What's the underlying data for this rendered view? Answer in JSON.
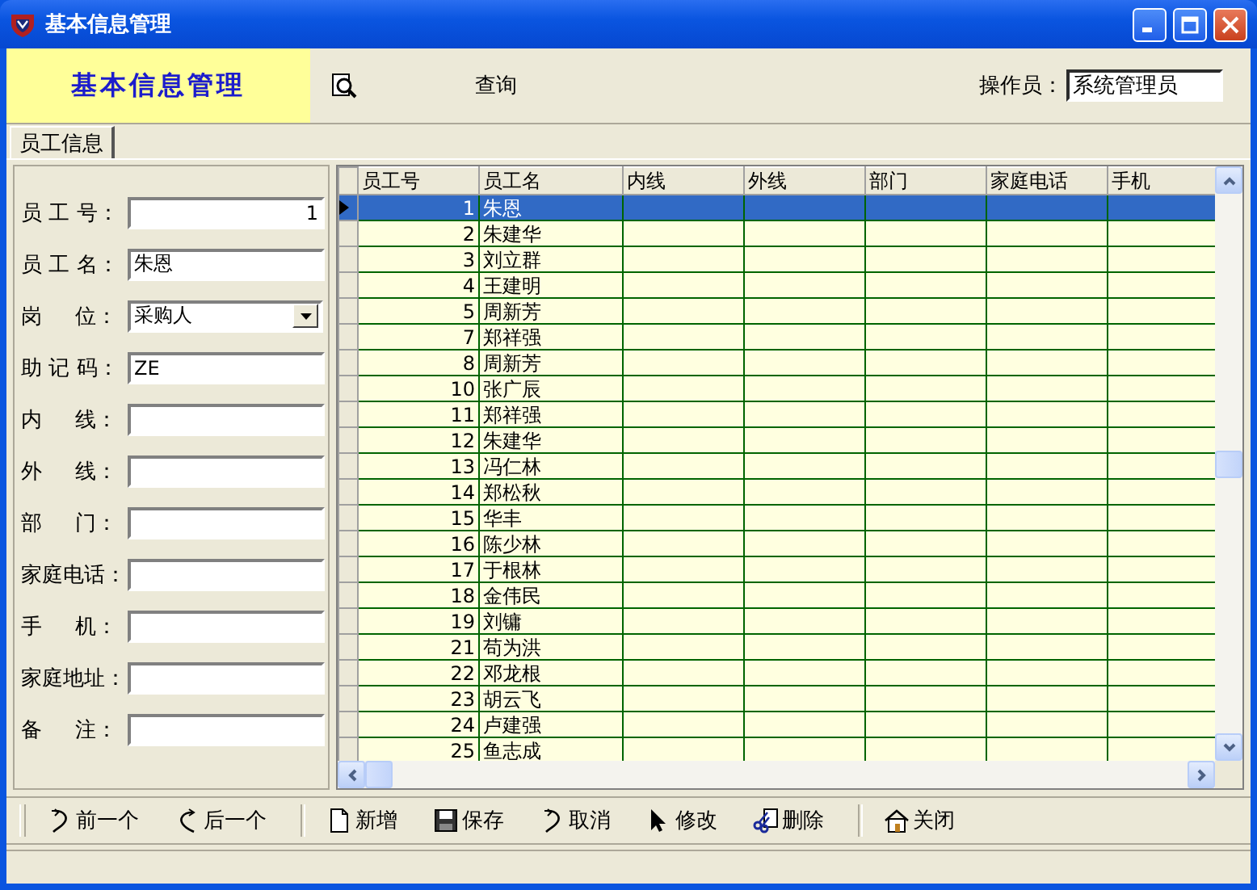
{
  "window": {
    "title": "基本信息管理"
  },
  "header": {
    "banner": "基本信息管理",
    "query_button": "查询",
    "operator_label": "操作员：",
    "operator_value": "系统管理员"
  },
  "tabs": [
    {
      "label": "员工信息",
      "selected": true
    }
  ],
  "form": {
    "fields": [
      {
        "label": "员 工 号：",
        "kind": "number",
        "value": "1"
      },
      {
        "label": "员 工 名：",
        "kind": "text",
        "value": "朱恩"
      },
      {
        "label": "岗     位：",
        "kind": "combo",
        "value": "采购人"
      },
      {
        "label": "助 记 码：",
        "kind": "text",
        "value": "ZE"
      },
      {
        "label": "内     线：",
        "kind": "text"
      },
      {
        "label": "外     线：",
        "kind": "text"
      },
      {
        "label": "部     门：",
        "kind": "text"
      },
      {
        "label": "家庭电话：",
        "kind": "text"
      },
      {
        "label": "手     机：",
        "kind": "text"
      },
      {
        "label": "家庭地址：",
        "kind": "text"
      },
      {
        "label": "备     注：",
        "kind": "text"
      }
    ]
  },
  "table": {
    "columns": [
      "员工号",
      "员工名",
      "内线",
      "外线",
      "部门",
      "家庭电话",
      "手机"
    ],
    "rows": [
      {
        "id": "1",
        "name": "朱恩",
        "selected": true
      },
      {
        "id": "2",
        "name": "朱建华",
        "selected": false
      },
      {
        "id": "3",
        "name": "刘立群",
        "selected": false
      },
      {
        "id": "4",
        "name": "王建明",
        "selected": false
      },
      {
        "id": "5",
        "name": "周新芳",
        "selected": false
      },
      {
        "id": "7",
        "name": "郑祥强",
        "selected": false
      },
      {
        "id": "8",
        "name": "周新芳",
        "selected": false
      },
      {
        "id": "10",
        "name": "张广辰",
        "selected": false
      },
      {
        "id": "11",
        "name": "郑祥强",
        "selected": false
      },
      {
        "id": "12",
        "name": "朱建华",
        "selected": false
      },
      {
        "id": "13",
        "name": "冯仁林",
        "selected": false
      },
      {
        "id": "14",
        "name": "郑松秋",
        "selected": false
      },
      {
        "id": "15",
        "name": "华丰",
        "selected": false
      },
      {
        "id": "16",
        "name": "陈少林",
        "selected": false
      },
      {
        "id": "17",
        "name": "于根林",
        "selected": false
      },
      {
        "id": "18",
        "name": "金伟民",
        "selected": false
      },
      {
        "id": "19",
        "name": "刘镛",
        "selected": false
      },
      {
        "id": "21",
        "name": "苟为洪",
        "selected": false
      },
      {
        "id": "22",
        "name": "邓龙根",
        "selected": false
      },
      {
        "id": "23",
        "name": "胡云飞",
        "selected": false
      },
      {
        "id": "24",
        "name": "卢建强",
        "selected": false
      },
      {
        "id": "25",
        "name": "鱼志成",
        "selected": false
      }
    ]
  },
  "toolbar": {
    "buttons": [
      {
        "label": "前一个",
        "kind": "prev",
        "separator_before": false
      },
      {
        "label": "后一个",
        "kind": "next",
        "separator_before": false
      },
      {
        "label": "新增",
        "kind": "new",
        "separator_before": true
      },
      {
        "label": "保存",
        "kind": "save",
        "separator_before": false
      },
      {
        "label": "取消",
        "kind": "cancel",
        "separator_before": false
      },
      {
        "label": "修改",
        "kind": "edit",
        "separator_before": false
      },
      {
        "label": "删除",
        "kind": "delete",
        "separator_before": false
      },
      {
        "label": "关闭",
        "kind": "close",
        "separator_before": true
      }
    ]
  }
}
